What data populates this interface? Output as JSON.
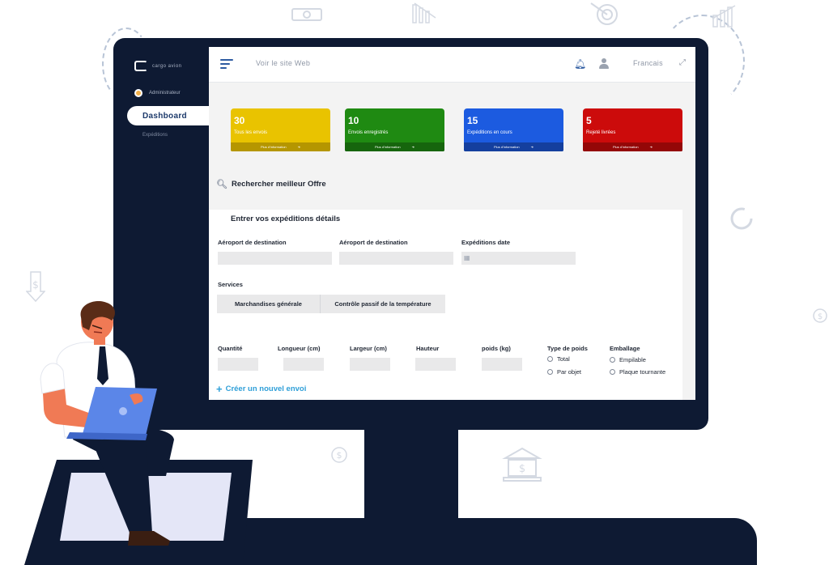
{
  "sidebar": {
    "logo_text": "cargo avion",
    "user_name": "Administrateur",
    "active_item": "Dashboard",
    "sub_item": "Expéditions"
  },
  "topbar": {
    "visit_link": "Voir le site Web",
    "language": "Francais"
  },
  "cards": [
    {
      "count": "30",
      "label": "Tous les envois",
      "footer": "Plus d'information",
      "color": "#e9c300",
      "foot_color": "#b59600"
    },
    {
      "count": "10",
      "label": "Envois enregistrés",
      "footer": "Plus d'information",
      "color": "#1f8a12",
      "foot_color": "#16650d"
    },
    {
      "count": "15",
      "label": "Expéditions en cours",
      "footer": "Plus d'information",
      "color": "#1c5be0",
      "foot_color": "#143f9e"
    },
    {
      "count": "5",
      "label": "Rejeté livrées",
      "footer": "Plus d'information",
      "color": "#cc0b0b",
      "foot_color": "#940707"
    }
  ],
  "search": {
    "title": "Rechercher meilleur Offre"
  },
  "form": {
    "title": "Entrer vos expéditions détails",
    "dest1_label": "Aéroport de destination",
    "dest2_label": "Aéroport de destination",
    "date_label": "Expéditions date",
    "services_label": "Services",
    "services": [
      "Marchandises générale",
      "Contrôle passif de la température"
    ],
    "quantity_label": "Quantité",
    "length_label": "Longueur (cm)",
    "width_label": "Largeur (cm)",
    "height_label": "Hauteur",
    "weight_label": "poids (kg)",
    "weight_type_label": "Type de poids",
    "weight_type_options": [
      "Total",
      "Par objet"
    ],
    "packaging_label": "Emballage",
    "packaging_options": [
      "Empilable",
      "Plaque tournante"
    ],
    "create_link": "Créer un nouvel envoi"
  },
  "colors": {
    "monitor": "#0e1a33",
    "accent": "#2c5aa0",
    "link": "#2f9fd8"
  }
}
